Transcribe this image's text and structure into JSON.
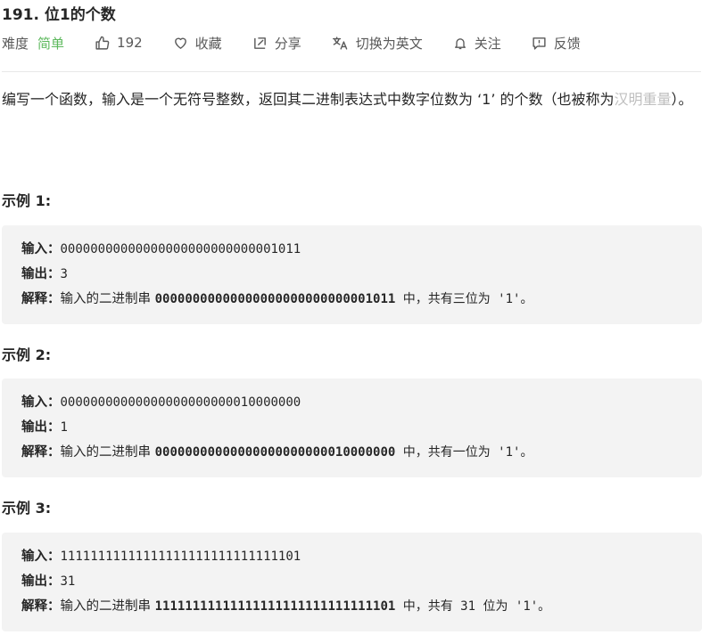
{
  "problem": {
    "title": "191. 位1的个数",
    "difficulty_label": "难度",
    "difficulty_value": "简单",
    "likes": "192",
    "favorite_label": "收藏",
    "share_label": "分享",
    "switch_lang_label": "切换为英文",
    "follow_label": "关注",
    "feedback_label": "反馈"
  },
  "description": {
    "text_before": "编写一个函数，输入是一个无符号整数，返回其二进制表达式中数字位数为 ‘1’ 的个数（也被称为",
    "term": "汉明重量",
    "text_after": "）。"
  },
  "examples": [
    {
      "heading": "示例 1:",
      "input_label": "输入：",
      "input_value": "00000000000000000000000000001011",
      "output_label": "输出：",
      "output_value": "3",
      "explain_label": "解释：",
      "explain_prefix": "输入的二进制串 ",
      "explain_bits": "00000000000000000000000000001011",
      "explain_suffix": " 中，共有三位为 '1'。"
    },
    {
      "heading": "示例 2:",
      "input_label": "输入：",
      "input_value": "00000000000000000000000010000000",
      "output_label": "输出：",
      "output_value": "1",
      "explain_label": "解释：",
      "explain_prefix": "输入的二进制串 ",
      "explain_bits": "00000000000000000000000010000000",
      "explain_suffix": " 中，共有一位为 '1'。"
    },
    {
      "heading": "示例 3:",
      "input_label": "输入：",
      "input_value": "11111111111111111111111111111101",
      "output_label": "输出：",
      "output_value": "31",
      "explain_label": "解释：",
      "explain_prefix": "输入的二进制串 ",
      "explain_bits": "11111111111111111111111111111101",
      "explain_suffix": " 中，共有 31 位为 '1'。"
    }
  ],
  "colors": {
    "difficulty_easy": "#5cb85c",
    "example_bg": "#f3f3f3",
    "term_link": "#bfbfbf"
  },
  "icons": [
    "thumbs-up-icon",
    "heart-icon",
    "share-icon",
    "translate-icon",
    "bell-icon",
    "feedback-icon"
  ]
}
